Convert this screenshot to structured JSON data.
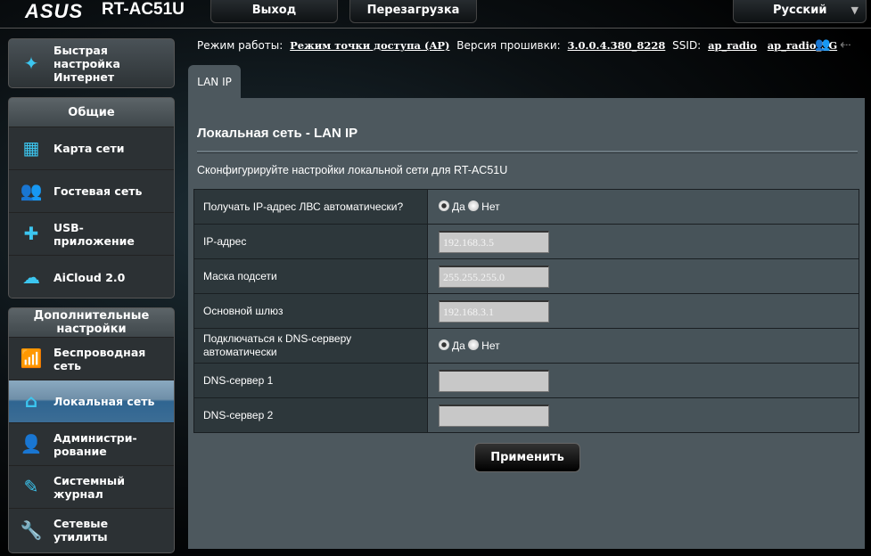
{
  "header": {
    "logo": "ASUS",
    "model": "RT-AC51U",
    "logout": "Выход",
    "reboot": "Перезагрузка",
    "language": "Русский"
  },
  "status": {
    "mode_label": "Режим работы:",
    "mode_value": "Режим точки доступа (AP)",
    "fw_label": "Версия прошивки:",
    "fw_value": "3.0.0.4.380_8228",
    "ssid_label": "SSID:",
    "ssid1": "ap_radio",
    "ssid2": "ap_radio_5G"
  },
  "sidebar": {
    "quick": "Быстрая настройка Интернет",
    "general_title": "Общие",
    "general": [
      {
        "label": "Карта сети"
      },
      {
        "label": "Гостевая сеть"
      },
      {
        "label": "USB-приложение"
      },
      {
        "label": "AiCloud 2.0"
      }
    ],
    "advanced_title": "Дополнительные настройки",
    "advanced": [
      {
        "label": "Беспроводная сеть"
      },
      {
        "label": "Локальная сеть"
      },
      {
        "label": "Администри-рование"
      },
      {
        "label": "Системный журнал"
      },
      {
        "label": "Сетевые утилиты"
      }
    ]
  },
  "main": {
    "tab": "LAN IP",
    "title": "Локальная сеть - LAN IP",
    "desc": "Сконфигурируйте настройки локальной сети для RT-AC51U",
    "rows": [
      {
        "label": "Получать IP-адрес ЛВС автоматически?",
        "yes": "Да",
        "no": "Нет"
      },
      {
        "label": "IP-адрес",
        "value": "192.168.3.5"
      },
      {
        "label": "Маска подсети",
        "value": "255.255.255.0"
      },
      {
        "label": "Основной шлюз",
        "value": "192.168.3.1"
      },
      {
        "label": "Подключаться к DNS-серверу автоматически",
        "yes": "Да",
        "no": "Нет"
      },
      {
        "label": "DNS-сервер 1",
        "value": ""
      },
      {
        "label": "DNS-сервер 2",
        "value": ""
      }
    ],
    "apply": "Применить"
  }
}
